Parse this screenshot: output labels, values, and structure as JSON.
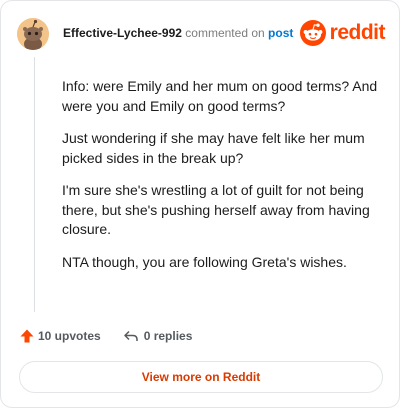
{
  "header": {
    "username": "Effective-Lychee-992",
    "action_text": "commented on",
    "post_link": "post",
    "brand_name": "reddit"
  },
  "comment": {
    "paragraphs": [
      "Info: were Emily and her mum on good terms? And were you and Emily on good terms?",
      "Just wondering if she may have felt like her mum picked sides in the break up?",
      "I'm sure she's wrestling a lot of guilt for not being there, but she's pushing herself away from having closure.",
      "NTA though, you are following Greta's wishes."
    ]
  },
  "actions": {
    "upvotes": "10 upvotes",
    "replies": "0 replies"
  },
  "view_more": {
    "label": "View more on Reddit"
  },
  "colors": {
    "brand": "#ff4500",
    "link": "#0079d3",
    "view_more_text": "#d93a00"
  },
  "icons": {
    "avatar": "snoo-avatar",
    "logo": "reddit-snoo-logo",
    "upvote": "upvote-arrow-icon",
    "reply": "reply-arrow-icon"
  }
}
